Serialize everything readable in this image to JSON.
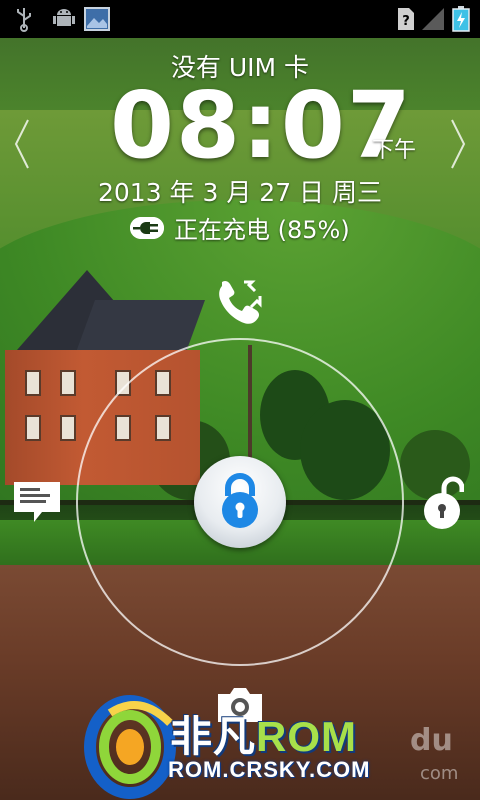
{
  "status_bar": {
    "icons": [
      "usb-icon",
      "android-debug-icon",
      "image-notification-icon",
      "no-sim-icon",
      "signal-icon",
      "battery-charging-icon"
    ]
  },
  "lockscreen": {
    "carrier": "没有 UIM 卡",
    "time": "08:07",
    "ampm": "下午",
    "date": "2013 年 3 月 27 日 周三",
    "charging": "正在充电 (85%)",
    "battery_level_percent": 85
  },
  "unlock_targets": [
    "phone-icon",
    "message-icon",
    "unlock-icon",
    "camera-icon"
  ],
  "watermark": {
    "brand_cn": "非凡",
    "brand_rom": "ROM",
    "url": "ROM.CRSKY.COM",
    "partial": "du",
    "partial2": "com"
  },
  "colors": {
    "accent_blue": "#1e88e5",
    "brand_green": "#a8e04a"
  }
}
